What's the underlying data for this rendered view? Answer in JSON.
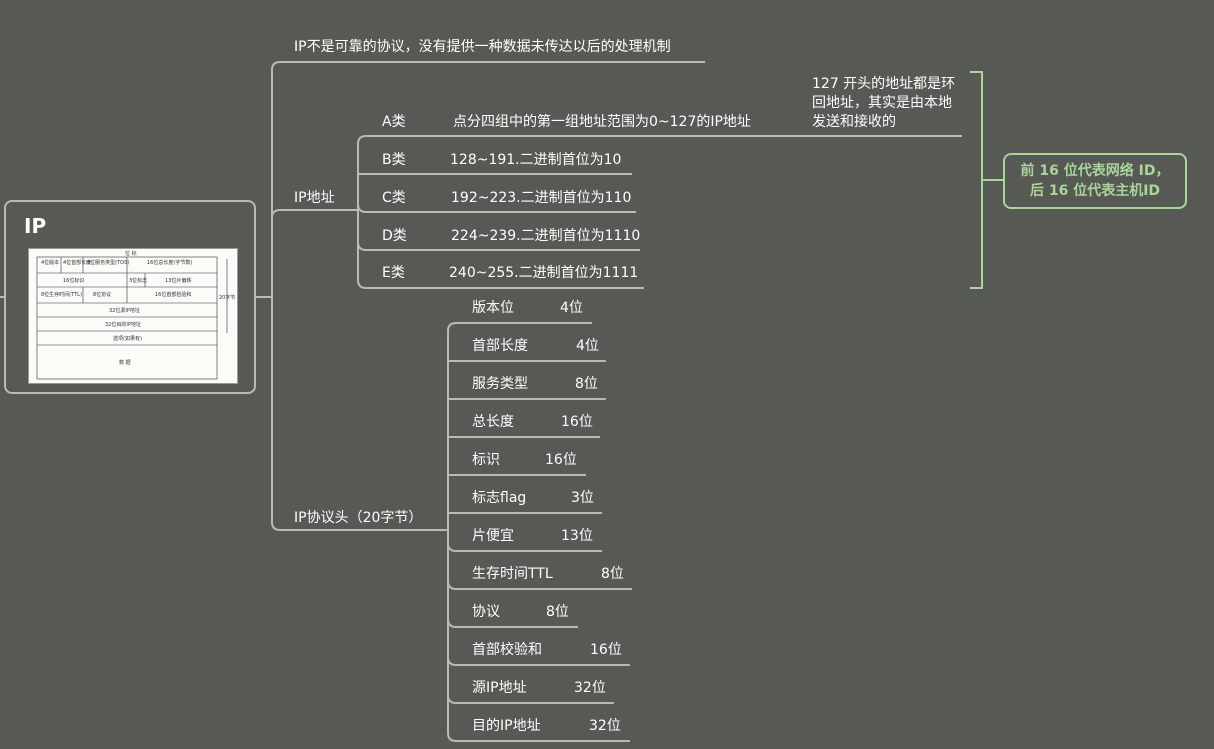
{
  "root": {
    "title": "IP",
    "image": {
      "top_label": "位 标",
      "cells": [
        "4位版本",
        "4位首部长度",
        "8位服务类型(TOS)",
        "16位总长度(字节数)",
        "16位标识",
        "3位标志",
        "13位片偏移",
        "8位生存时间(TTL)",
        "8位协议",
        "16位首部检验和",
        "32位源IP地址",
        "32位目的IP地址",
        "选项(如果有)",
        "数 据"
      ],
      "side_label": "20字节"
    }
  },
  "branches": {
    "unreliable": "IP不是可靠的协议，没有提供一种数据未传达以后的处理机制",
    "address": "IP地址",
    "header": "IP协议头（20字节）"
  },
  "classes": [
    {
      "name": "A类",
      "desc": "点分四组中的第一组地址范围为0~127的IP地址"
    },
    {
      "name": "B类",
      "desc": "128~191.二进制首位为10"
    },
    {
      "name": "C类",
      "desc": "192~223.二进制首位为110"
    },
    {
      "name": "D类",
      "desc": "224~239.二进制首位为1110"
    },
    {
      "name": "E类",
      "desc": "240~255.二进制首位为1111"
    }
  ],
  "note": "127 开头的地址都是环回地址，其实是由本地发送和接收的",
  "callout": {
    "line1": "前 16 位代表网络 ID，",
    "line2": "后 16 位代表主机ID"
  },
  "fields": [
    {
      "name": "版本位",
      "bits": "4位"
    },
    {
      "name": "首部长度",
      "bits": "4位"
    },
    {
      "name": "服务类型",
      "bits": "8位"
    },
    {
      "name": "总长度",
      "bits": "16位"
    },
    {
      "name": "标识",
      "bits": "16位"
    },
    {
      "name": "标志flag",
      "bits": "3位"
    },
    {
      "name": "片便宜",
      "bits": "13位"
    },
    {
      "name": "生存时间TTL",
      "bits": "8位"
    },
    {
      "name": "协议",
      "bits": "8位"
    },
    {
      "name": "首部校验和",
      "bits": "16位"
    },
    {
      "name": "源IP地址",
      "bits": "32位"
    },
    {
      "name": "目的IP地址",
      "bits": "32位"
    }
  ],
  "colors": {
    "background": "#575955",
    "line": "#b9bab6",
    "accent": "#a9d59b"
  }
}
